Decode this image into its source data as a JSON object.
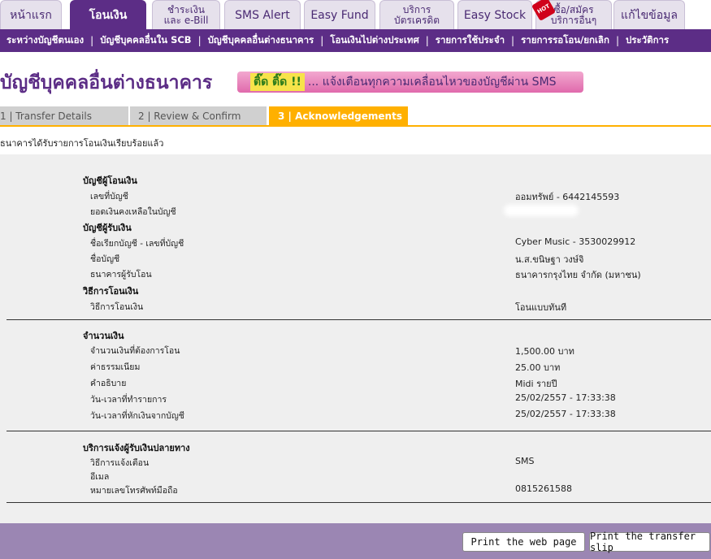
{
  "tabs": [
    {
      "label": "หน้าแรก"
    },
    {
      "label": "โอนเงิน"
    },
    {
      "label": "ชำระเงิน\nและ e-Bill"
    },
    {
      "label": "SMS Alert"
    },
    {
      "label": "Easy Fund"
    },
    {
      "label": "บริการ\nบัตรเครดิต"
    },
    {
      "label": "Easy Stock"
    },
    {
      "label": "ซื้อ/สมัคร\nบริการอื่นๆ"
    },
    {
      "label": "แก้ไขข้อมูล"
    }
  ],
  "hot_badge": "HOT",
  "subnav": [
    "ระหว่างบัญชีตนเอง",
    "บัญชีบุคคลอื่นใน SCB",
    "บัญชีบุคคลอื่นต่างธนาคาร",
    "โอนเงินไปต่างประเทศ",
    "รายการใช้ประจำ",
    "รายการรอโอน/ยกเลิก",
    "ประวัติการ"
  ],
  "page_title": "บัญชีบุคคลอื่นต่างธนาคาร",
  "banner": {
    "badge": "ติ๊ด ติ๊ด !!",
    "text": "... แจ้งเตือนทุกความเคลื่อนไหวของบัญชีผ่าน SMS"
  },
  "steps": [
    {
      "label": "1 | Transfer Details"
    },
    {
      "label": "2 | Review & Confirm"
    },
    {
      "label": "3 | Acknowledgements"
    }
  ],
  "message": "ธนาคารได้รับรายการโอนเงินเรียบร้อยแล้ว",
  "sections": {
    "from_account": {
      "heading": "บัญชีผู้โอนเงิน",
      "account_no_label": "เลขที่บัญชี",
      "account_no_value": "ออมทรัพย์ - 6442145593",
      "balance_label": "ยอดเงินคงเหลือในบัญชี"
    },
    "to_account": {
      "heading": "บัญชีผู้รับเงิน",
      "nickname_label": "ชื่อเรียกบัญชี - เลขที่บัญชี",
      "nickname_value": "Cyber Music - 3530029912",
      "name_label": "ชื่อบัญชี",
      "name_value": "น.ส.ขนิษฐา วงษ์จิ",
      "bank_label": "ธนาคารผู้รับโอน",
      "bank_value": "ธนาคารกรุงไทย จำกัด (มหาชน)"
    },
    "method": {
      "heading": "วิธีการโอนเงิน",
      "method_label": "วิธีการโอนเงิน",
      "method_value": "โอนแบบทันที"
    },
    "amount": {
      "heading": "จำนวนเงิน",
      "amount_label": "จำนวนเงินที่ต้องการโอน",
      "amount_value": "1,500.00 บาท",
      "fee_label": "ค่าธรรมเนียม",
      "fee_value": "25.00 บาท",
      "desc_label": "คำอธิบาย",
      "desc_value": "Midi รายปี",
      "txn_time_label": "วัน-เวลาที่ทำรายการ",
      "txn_time_value": "25/02/2557 - 17:33:38",
      "debit_time_label": "วัน-เวลาที่หักเงินจากบัญชี",
      "debit_time_value": "25/02/2557 - 17:33:38"
    },
    "notify": {
      "heading": "บริการแจ้งผู้รับเงินปลายทาง",
      "method_label": "วิธีการแจ้งเตือน",
      "method_value": "SMS",
      "email_label": "อีเมล",
      "phone_label": "หมายเลขโทรศัพท์มือถือ",
      "phone_value": "0815261588"
    }
  },
  "buttons": {
    "print_page": "Print the web page",
    "print_slip": "Print the transfer slip"
  }
}
